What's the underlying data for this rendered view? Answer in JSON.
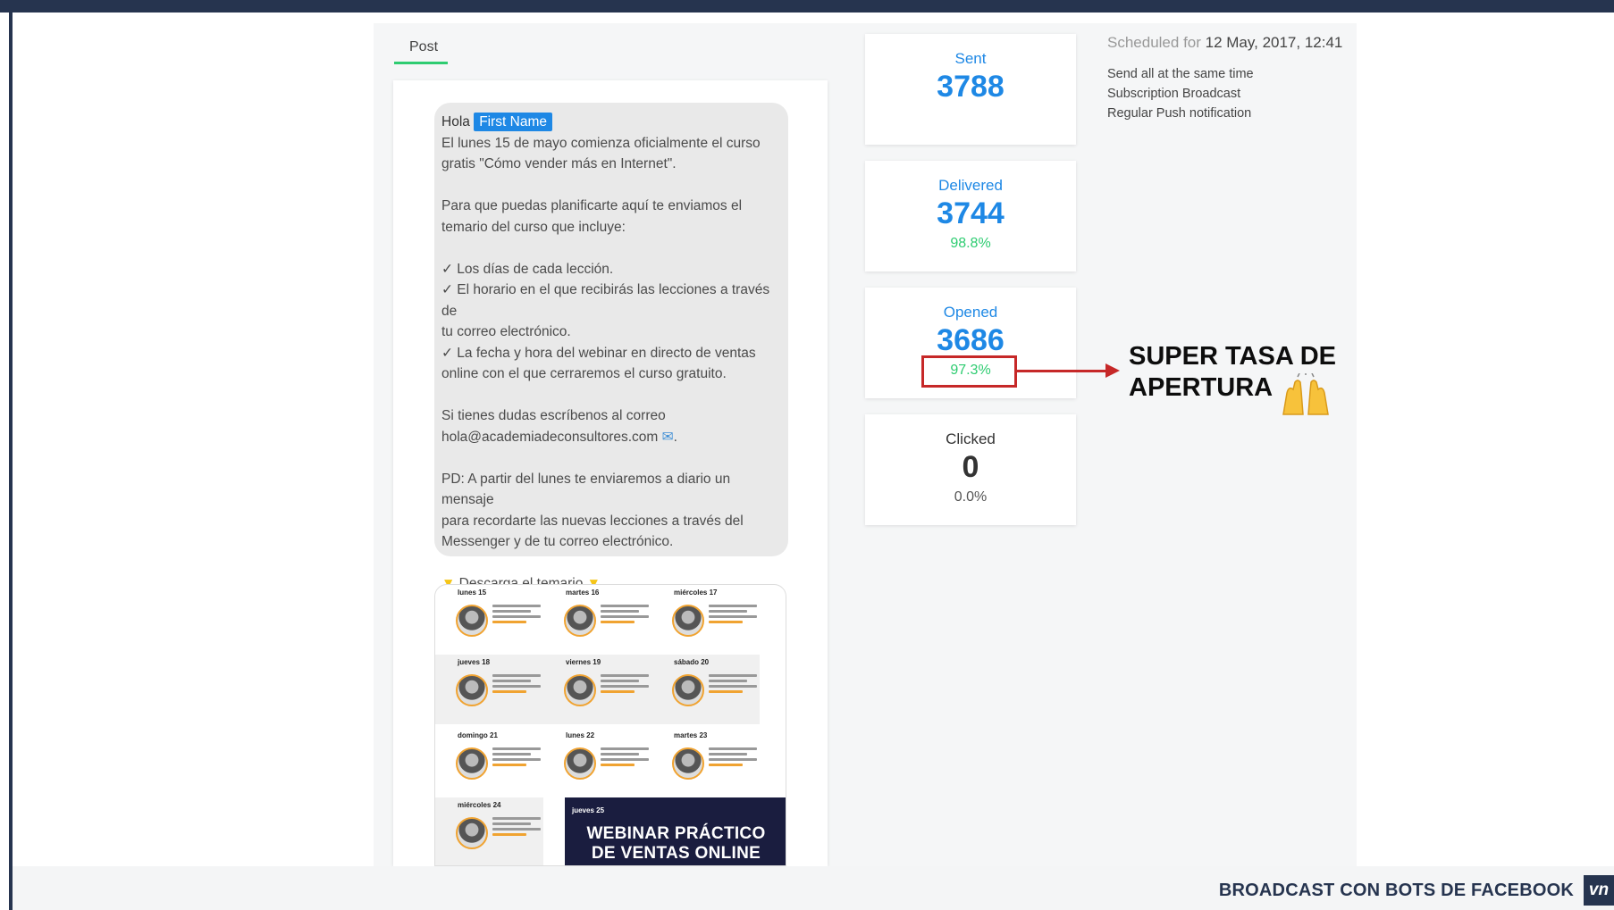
{
  "tab": {
    "label": "Post"
  },
  "message": {
    "greeting": "Hola",
    "first_name_tag": "First Name",
    "lines": [
      "El lunes 15 de mayo comienza oficialmente el curso",
      "gratis \"Cómo vender más en Internet\".",
      "",
      "Para que puedas planificarte aquí te enviamos el",
      "temario del curso que incluye:",
      "",
      "✓ Los días de cada lección.",
      "✓ El horario en el que recibirás las lecciones a través de",
      "tu correo electrónico.",
      "✓ La fecha y hora del webinar en directo de ventas",
      "online con el que cerraremos el curso gratuito.",
      "",
      "Si tienes dudas escríbenos al correo",
      "hola@academiadeconsultores.com",
      "",
      "PD: A partir del lunes te enviaremos a diario un mensaje",
      "para recordarte las nuevas lecciones a través del",
      "Messenger y de tu correo electrónico.",
      ""
    ],
    "download_label": "Descarga el temario"
  },
  "preview": {
    "days": [
      "lunes 15",
      "martes 16",
      "miércoles 17",
      "jueves 18",
      "viernes 19",
      "sábado 20",
      "domingo 21",
      "lunes 22",
      "martes 23",
      "miércoles 24"
    ],
    "webinar_day": "jueves 25",
    "webinar_title_1": "WEBINAR PRÁCTICO",
    "webinar_title_2": "DE VENTAS ONLINE"
  },
  "stats": [
    {
      "label": "Sent",
      "value": "3788",
      "pct": ""
    },
    {
      "label": "Delivered",
      "value": "3744",
      "pct": "98.8%"
    },
    {
      "label": "Opened",
      "value": "3686",
      "pct": "97.3%"
    },
    {
      "label": "Clicked",
      "value": "0",
      "pct": "0.0%"
    }
  ],
  "schedule": {
    "prefix": "Scheduled for",
    "datetime": "12 May, 2017, 12:41",
    "details": [
      "Send all at the same time",
      "Subscription Broadcast",
      "Regular Push notification"
    ]
  },
  "callout": {
    "line1": "SUPER TASA DE",
    "line2": "APERTURA"
  },
  "footer": {
    "title": "BROADCAST CON BOTS DE FACEBOOK",
    "logo": "vn"
  },
  "colors": {
    "accent": "#1e88e5",
    "success": "#2ecc71",
    "highlight": "#c62828",
    "brand": "#26344f"
  }
}
